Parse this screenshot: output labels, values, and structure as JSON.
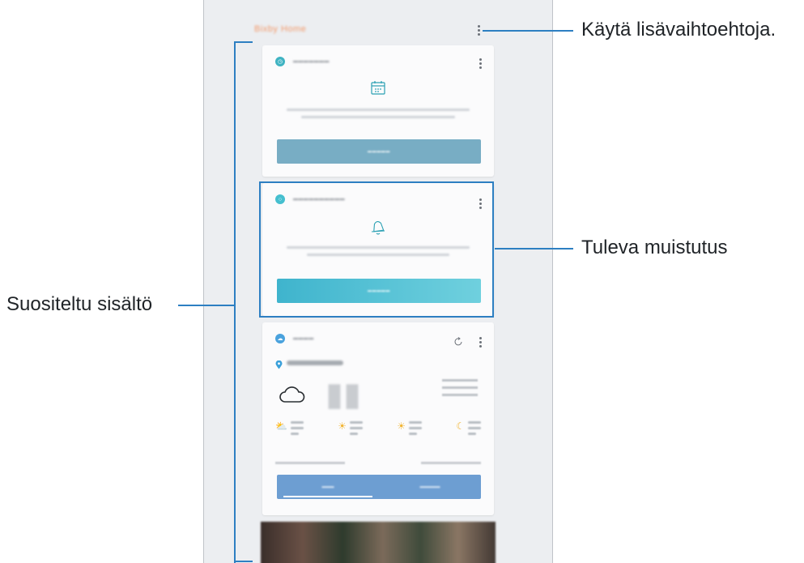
{
  "annotations": {
    "more_options": "Käytä lisävaihtoehtoja.",
    "upcoming_reminder": "Tuleva muistutus",
    "recommended_content": "Suositeltu sisältö"
  },
  "phone": {
    "app_title": "Bixby Home"
  },
  "cards": {
    "schedule": {
      "icon": "calendar-icon",
      "button_color": "#78adc4"
    },
    "reminder": {
      "icon": "bell-icon",
      "button_color": "#5bc3d7"
    },
    "weather": {
      "icon": "location-pin-icon",
      "tabs_color": "#6d9ed2"
    }
  },
  "colors": {
    "callout": "#2d7fc2",
    "app_title": "#f39a6b",
    "phone_bg": "#eceef1"
  }
}
